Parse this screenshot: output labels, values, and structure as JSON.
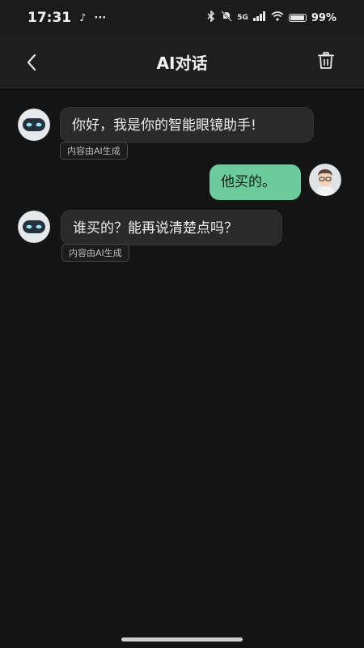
{
  "status_bar": {
    "time": "17:31",
    "network": "5G",
    "battery_percent": "99%"
  },
  "header": {
    "title": "AI对话"
  },
  "messages": [
    {
      "role": "ai",
      "text": "你好，我是你的智能眼镜助手!",
      "tag": "内容由AI生成"
    },
    {
      "role": "user",
      "text": "他买的。"
    },
    {
      "role": "ai",
      "text": "谁买的？能再说清楚点吗？",
      "tag": "内容由AI生成"
    }
  ],
  "colors": {
    "user_bubble": "#6ccb9b",
    "ai_bubble": "#2a2a2a",
    "background": "#141414"
  }
}
